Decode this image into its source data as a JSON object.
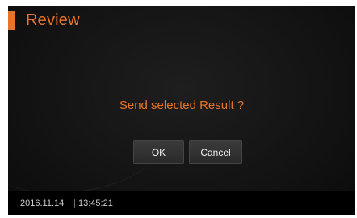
{
  "header": {
    "title": "Review"
  },
  "dialog": {
    "message": "Send selected Result ?",
    "ok_label": "OK",
    "cancel_label": "Cancel"
  },
  "status": {
    "date": "2016.11.14",
    "separator": "|",
    "time": "13:45:21"
  },
  "colors": {
    "accent": "#e8742a",
    "background": "#141414",
    "status_bar": "#000000",
    "button": "#333333"
  }
}
